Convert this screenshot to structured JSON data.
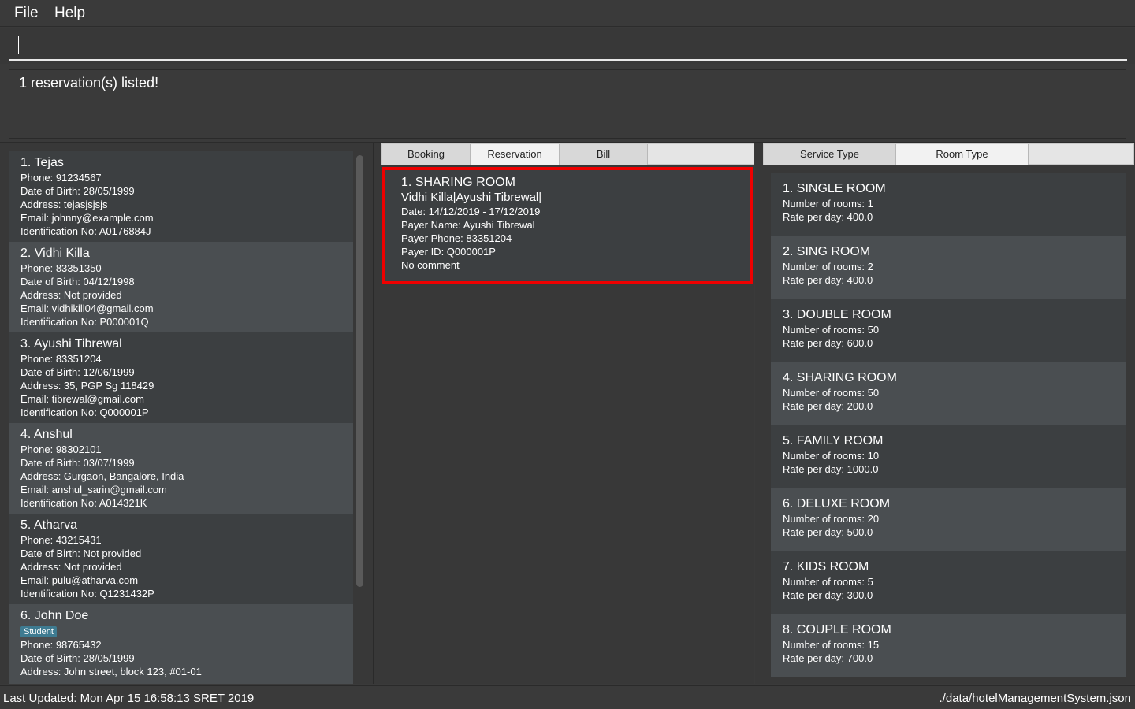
{
  "menu": {
    "file": "File",
    "help": "Help"
  },
  "command": {
    "value": "",
    "placeholder": ""
  },
  "result": {
    "message": "1 reservation(s) listed!"
  },
  "guests": [
    {
      "title": "1.  Tejas",
      "tag": "",
      "lines": [
        "Phone: 91234567",
        "Date of Birth: 28/05/1999",
        "Address: tejasjsjsjs",
        "Email: johnny@example.com",
        "Identification No: A0176884J"
      ]
    },
    {
      "title": "2.  Vidhi Killa",
      "tag": "",
      "lines": [
        "Phone: 83351350",
        "Date of Birth: 04/12/1998",
        "Address: Not provided",
        "Email: vidhikill04@gmail.com",
        "Identification No: P000001Q"
      ]
    },
    {
      "title": "3.  Ayushi Tibrewal",
      "tag": "",
      "lines": [
        "Phone: 83351204",
        "Date of Birth: 12/06/1999",
        "Address: 35, PGP Sg 118429",
        "Email: tibrewal@gmail.com",
        "Identification No: Q000001P"
      ]
    },
    {
      "title": "4.  Anshul",
      "tag": "",
      "lines": [
        "Phone: 98302101",
        "Date of Birth: 03/07/1999",
        "Address: Gurgaon, Bangalore, India",
        "Email: anshul_sarin@gmail.com",
        "Identification No: A014321K"
      ]
    },
    {
      "title": "5.  Atharva",
      "tag": "",
      "lines": [
        "Phone: 43215431",
        "Date of Birth: Not provided",
        "Address: Not provided",
        "Email: pulu@atharva.com",
        "Identification No: Q1231432P"
      ]
    },
    {
      "title": "6.  John Doe",
      "tag": "Student",
      "lines": [
        "Phone: 98765432",
        "Date of Birth: 28/05/1999",
        "Address: John street, block 123, #01-01"
      ]
    }
  ],
  "mid_tabs": {
    "booking": "Booking",
    "reservation": "Reservation",
    "bill": "Bill"
  },
  "reservation": {
    "title": "1.  SHARING ROOM",
    "guests": "Vidhi Killa|Ayushi Tibrewal|",
    "lines": [
      "Date: 14/12/2019 - 17/12/2019",
      "Payer Name: Ayushi Tibrewal",
      "Payer Phone: 83351204",
      "Payer ID: Q000001P",
      "No comment"
    ]
  },
  "right_tabs": {
    "service_type": "Service Type",
    "room_type": "Room Type"
  },
  "rooms": [
    {
      "title": "1.  SINGLE ROOM",
      "count": "Number of rooms: 1",
      "rate": "Rate per day: 400.0"
    },
    {
      "title": "2.  SING ROOM",
      "count": "Number of rooms: 2",
      "rate": "Rate per day: 400.0"
    },
    {
      "title": "3.  DOUBLE ROOM",
      "count": "Number of rooms: 50",
      "rate": "Rate per day: 600.0"
    },
    {
      "title": "4.  SHARING ROOM",
      "count": "Number of rooms: 50",
      "rate": "Rate per day: 200.0"
    },
    {
      "title": "5.  FAMILY ROOM",
      "count": "Number of rooms: 10",
      "rate": "Rate per day: 1000.0"
    },
    {
      "title": "6.  DELUXE ROOM",
      "count": "Number of rooms: 20",
      "rate": "Rate per day: 500.0"
    },
    {
      "title": "7.  KIDS ROOM",
      "count": "Number of rooms: 5",
      "rate": "Rate per day: 300.0"
    },
    {
      "title": "8.  COUPLE ROOM",
      "count": "Number of rooms: 15",
      "rate": "Rate per day: 700.0"
    }
  ],
  "status": {
    "last_updated": "Last Updated: Mon Apr 15 16:58:13 SRET 2019",
    "file_path": "./data/hotelManagementSystem.json"
  },
  "colors": {
    "highlight": "#ee0000",
    "tag_bg": "#3e7b91",
    "card_dark": "#3c3f41",
    "card_light": "#4a4e51"
  }
}
